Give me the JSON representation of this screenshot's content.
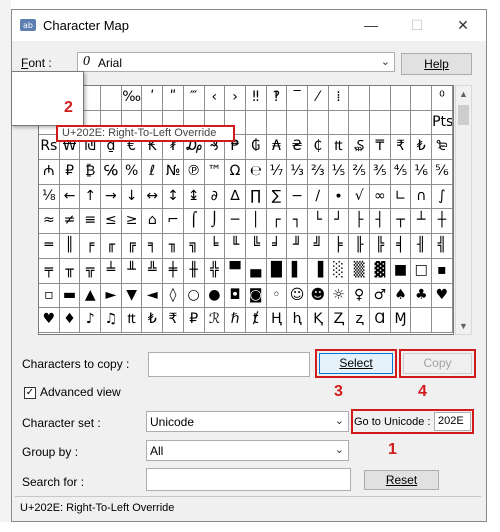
{
  "window": {
    "title": "Character Map",
    "minimize_glyph": "—",
    "maximize_glyph": "☐",
    "close_glyph": "✕"
  },
  "font": {
    "label_underlined": "F",
    "label_rest": "ont :",
    "glyph": "0",
    "value": "Arial",
    "help_button": "Help"
  },
  "characters": [
    [
      "",
      "",
      "",
      "",
      "‰",
      "ʹ",
      "ʺ",
      "‴",
      "‹",
      "›",
      "‼",
      "‽",
      "‾",
      "⁄",
      "⁞",
      "",
      "",
      "",
      "",
      "⁰"
    ],
    [
      "",
      "",
      "",
      "",
      "",
      "",
      "",
      "",
      "",
      "",
      "",
      "",
      "",
      "",
      "",
      "",
      "",
      "",
      "",
      "Pts"
    ],
    [
      "Rs",
      "₩",
      "₪",
      "₫",
      "€",
      "₭",
      "₮",
      "₯",
      "₰",
      "₱",
      "₲",
      "₳",
      "₴",
      "₵",
      "₶",
      "₷",
      "₸",
      "₹",
      "₺",
      "₻"
    ],
    [
      "₼",
      "₽",
      "₿",
      "℅",
      "%",
      "ℓ",
      "№",
      "℗",
      "™",
      "Ω",
      "℮",
      "⅐",
      "⅓",
      "⅔",
      "⅕",
      "⅖",
      "⅗",
      "⅘",
      "⅙",
      "⅚"
    ],
    [
      "⅛",
      "←",
      "↑",
      "→",
      "↓",
      "↔",
      "↕",
      "↨",
      "∂",
      "∆",
      "∏",
      "∑",
      "−",
      "∕",
      "∙",
      "√",
      "∞",
      "∟",
      "∩",
      "∫"
    ],
    [
      "≈",
      "≠",
      "≡",
      "≤",
      "≥",
      "⌂",
      "⌐",
      "⌠",
      "⌡",
      "─",
      "│",
      "┌",
      "┐",
      "└",
      "┘",
      "├",
      "┤",
      "┬",
      "┴",
      "┼"
    ],
    [
      "═",
      "║",
      "╒",
      "╓",
      "╔",
      "╕",
      "╖",
      "╗",
      "╘",
      "╙",
      "╚",
      "╛",
      "╜",
      "╝",
      "╞",
      "╟",
      "╠",
      "╡",
      "╢",
      "╣"
    ],
    [
      "╤",
      "╥",
      "╦",
      "╧",
      "╨",
      "╩",
      "╪",
      "╫",
      "╬",
      "▀",
      "▄",
      "█",
      "▌",
      "▐",
      "░",
      "▒",
      "▓",
      "■",
      "□",
      "▪"
    ],
    [
      "▫",
      "▬",
      "▲",
      "►",
      "▼",
      "◄",
      "◊",
      "○",
      "●",
      "◘",
      "◙",
      "◦",
      "☺",
      "☻",
      "☼",
      "♀",
      "♂",
      "♠",
      "♣",
      "♥"
    ],
    [
      "♥",
      "♦",
      "♪",
      "♫",
      "₶",
      "₺",
      "₹",
      "₽",
      "ℛ",
      "ℏ",
      "ⱦ",
      "Ⱨ",
      "ⱨ",
      "Ⱪ",
      "Ⱬ",
      "ⱬ",
      "Ɑ",
      "Ɱ",
      "",
      ""
    ]
  ],
  "popup": {},
  "tooltip": "U+202E: Right-To-Left Override",
  "callouts": {
    "one": "1",
    "two": "2",
    "three": "3",
    "four": "4"
  },
  "copy_section": {
    "label": "Characters to copy :",
    "value": "",
    "select_button": "Select",
    "copy_button": "Copy"
  },
  "advanced_view": {
    "label": "Advanced view",
    "checked": "✓"
  },
  "character_set": {
    "label": "Character set :",
    "value": "Unicode"
  },
  "go_to_unicode": {
    "label": "Go to Unicode :",
    "value": "202E"
  },
  "group_by": {
    "label": "Group by :",
    "value": "All"
  },
  "search_for": {
    "label": "Search for :",
    "value": "",
    "reset_button": "Reset"
  },
  "status_bar": "U+202E: Right-To-Left Override",
  "colors": {
    "accent_red": "#d11b1b",
    "select_blue": "#0078d7"
  }
}
